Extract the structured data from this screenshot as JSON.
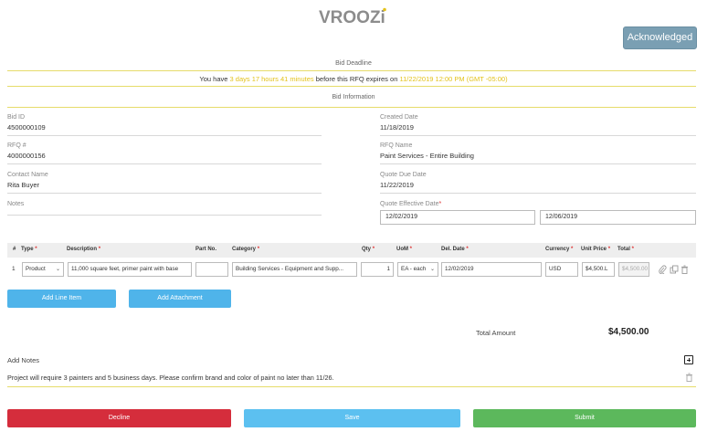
{
  "brand": {
    "logo_text": "VROOZi"
  },
  "header": {
    "acknowledged_label": "Acknowledged"
  },
  "deadline": {
    "section_title": "Bid Deadline",
    "prefix": "You have ",
    "remaining": "3 days 17 hours 41 minutes",
    "middle": " before this RFQ expires on ",
    "expires": "11/22/2019 12:00 PM (GMT -05:00)"
  },
  "bid_info": {
    "section_title": "Bid Information",
    "bid_id": {
      "label": "Bid ID",
      "value": "4500000109"
    },
    "rfq_no": {
      "label": "RFQ #",
      "value": "4000000156"
    },
    "contact_name": {
      "label": "Contact Name",
      "value": "Rita Buyer"
    },
    "notes": {
      "label": "Notes"
    },
    "created_date": {
      "label": "Created Date",
      "value": "11/18/2019"
    },
    "rfq_name": {
      "label": "RFQ Name",
      "value": "Paint Services - Entire Building"
    },
    "quote_due_date": {
      "label": "Quote Due Date",
      "value": "11/22/2019"
    },
    "quote_effective": {
      "label": "Quote Effective Date",
      "required": "*",
      "start": "12/02/2019",
      "end": "12/06/2019"
    }
  },
  "line_items": {
    "headers": {
      "num": "#",
      "type": "Type",
      "description": "Description",
      "part_no": "Part No.",
      "category": "Category",
      "qty": "Qty",
      "uom": "UoM",
      "del_date": "Del. Date",
      "currency": "Currency",
      "unit_price": "Unit Price",
      "total": "Total",
      "required": "*"
    },
    "rows": [
      {
        "num": "1",
        "type": "Product",
        "description": "11,000 square feet, primer paint with base",
        "part_no": "",
        "category": "Building Services - Equipment and Supp...",
        "qty": "1",
        "uom": "EA - each",
        "del_date": "12/02/2019",
        "currency": "USD",
        "unit_price": "$4,500.L",
        "total": "$4,500.00"
      }
    ],
    "add_line_item_label": "Add Line Item",
    "add_attachment_label": "Add Attachment"
  },
  "totals": {
    "label": "Total Amount",
    "value": "$4,500.00"
  },
  "notes_section": {
    "label": "Add Notes",
    "text": "Project will require 3 painters and 5 business days. Please confirm brand and color of paint no later than 11/26."
  },
  "footer": {
    "decline_label": "Decline",
    "save_label": "Save",
    "submit_label": "Submit"
  },
  "colors": {
    "accent_yellow": "#e3c21a",
    "button_blue": "#4fb4ea",
    "decline_red": "#d52d3c",
    "submit_green": "#5cb85c",
    "acknowledged": "#7a9fb3"
  },
  "icons": [
    "plus-box-icon",
    "trash-icon",
    "paperclip-icon",
    "copy-icon",
    "chevron-down-icon"
  ]
}
